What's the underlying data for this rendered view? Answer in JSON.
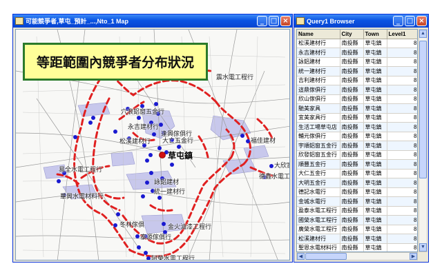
{
  "map_window": {
    "title": "可能競爭者,草屯_預計_...,Nto_1 Map",
    "banner": "等距範圍內競爭者分布狀況",
    "town_label": "草屯鎮",
    "labels": [
      "震水電工程行",
      "穴浪鋁窗五金行",
      "永吉建材行",
      "逢興傢俱行",
      "大亡五金行",
      "松溪建材行",
      "福佳建材",
      "易全水電工程行",
      "大欣家",
      "德鑫水電工",
      "詠鋁建材",
      "統一建材行",
      "華興水電材料行",
      "冬林傢俱",
      "金火油漆工程行",
      "泰源傢俱行",
      "阿榮水電工程行"
    ]
  },
  "query_window": {
    "title": "Query1 Browser",
    "columns": [
      "Name",
      "City",
      "Town",
      "Level1"
    ],
    "rows": [
      [
        "松溪建材行",
        "南投縣",
        "草屯鎮",
        "8"
      ],
      [
        "永吉建材行",
        "南投縣",
        "草屯鎮",
        "8"
      ],
      [
        "詠鋁建材",
        "南投縣",
        "草屯鎮",
        "8"
      ],
      [
        "統一建材行",
        "南投縣",
        "草屯鎮",
        "8"
      ],
      [
        "吉利建材行",
        "南投縣",
        "草屯鎮",
        "8"
      ],
      [
        "這鼎傢俱行",
        "南投縣",
        "草屯鎮",
        "8"
      ],
      [
        "欣山傢俱行",
        "南投縣",
        "草屯鎮",
        "8"
      ],
      [
        "馳美家具",
        "南投縣",
        "草屯鎮",
        "8"
      ],
      [
        "宜美家具行",
        "南投縣",
        "草屯鎮",
        "8"
      ],
      [
        "生活工場草屯店",
        "南投縣",
        "草屯鎮",
        "8"
      ],
      [
        "輔元傢俱行",
        "南投縣",
        "草屯鎮",
        "8"
      ],
      [
        "宇順鋁窗五金行",
        "南投縣",
        "草屯鎮",
        "8"
      ],
      [
        "欣發鋁窗五金行",
        "南投縣",
        "草屯鎮",
        "8"
      ],
      [
        "順豐五金行",
        "南投縣",
        "草屯鎮",
        "8"
      ],
      [
        "大仁五金行",
        "南投縣",
        "草屯鎮",
        "8"
      ],
      [
        "大明五金行",
        "南投縣",
        "草屯鎮",
        "8"
      ],
      [
        "德記水電行",
        "南投縣",
        "草屯鎮",
        "8"
      ],
      [
        "金城水電行",
        "南投縣",
        "草屯鎮",
        "8"
      ],
      [
        "盈泰水電工程行",
        "南投縣",
        "草屯鎮",
        "8"
      ],
      [
        "國榮水電工程行",
        "南投縣",
        "草屯鎮",
        "8"
      ],
      [
        "廣榮水電工程行",
        "南投縣",
        "草屯鎮",
        "8"
      ],
      [
        "松溪建材行",
        "南投縣",
        "草屯鎮",
        "8"
      ],
      [
        "聖恩水電材料行",
        "南投縣",
        "草屯鎮",
        "8"
      ]
    ]
  },
  "colors": {
    "titlebar": "#0a54e3",
    "banner_bg": "#ffff99",
    "banner_border": "#2a7a2a",
    "buffer_dash": "#e02020",
    "competitor_dot": "#1a1ad0",
    "town_dot": "#d01010",
    "landuse": "#c8c8ec"
  },
  "icons": {
    "minimize": "minimize-icon",
    "maximize": "maximize-icon",
    "close": "close-icon"
  }
}
